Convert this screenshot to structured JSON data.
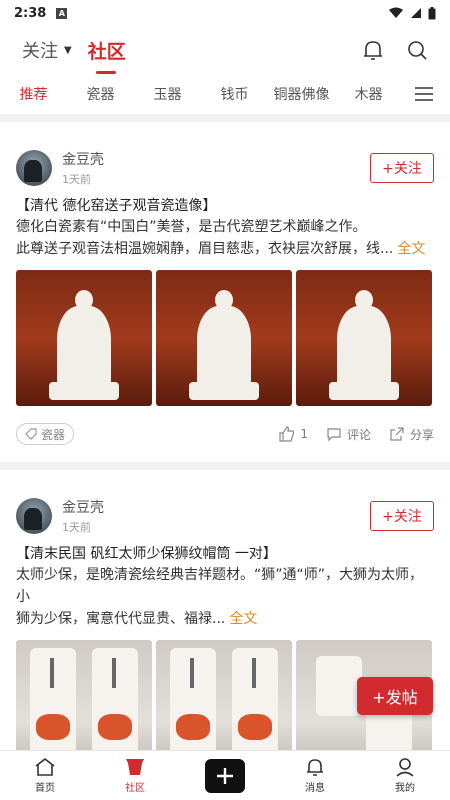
{
  "status": {
    "time": "2:38",
    "a_badge": "A"
  },
  "topnav": {
    "follow_label": "关注",
    "community_label": "社区"
  },
  "categories": [
    "推荐",
    "瓷器",
    "玉器",
    "钱币",
    "铜器佛像",
    "木器"
  ],
  "accent": "#d12a2f",
  "posts": [
    {
      "author": "金豆壳",
      "ago": "1天前",
      "follow": "+关注",
      "title": "【清代 德化窑送子观音瓷造像】",
      "body1": "德化白瓷素有“中国白”美誉，是古代瓷塑艺术巅峰之作。",
      "body2": "此尊送子观音法相温婉娴静，眉目慈悲，衣袂层次舒展，线...",
      "more": "全文",
      "tag": "瓷器",
      "likes": "1",
      "comment": "评论",
      "share": "分享"
    },
    {
      "author": "金豆壳",
      "ago": "1天前",
      "follow": "+关注",
      "title": "【清末民国 矾红太师少保狮纹帽筒 一对】",
      "body1": "太师少保，是晚清瓷绘经典吉祥题材。“狮”通“师”，大狮为太师，小",
      "body2": "狮为少保，寓意代代显贵、福禄...",
      "more": "全文"
    }
  ],
  "fab": "+发帖",
  "tabbar": {
    "home": "首页",
    "community": "社区",
    "messages": "消息",
    "mine": "我的"
  }
}
